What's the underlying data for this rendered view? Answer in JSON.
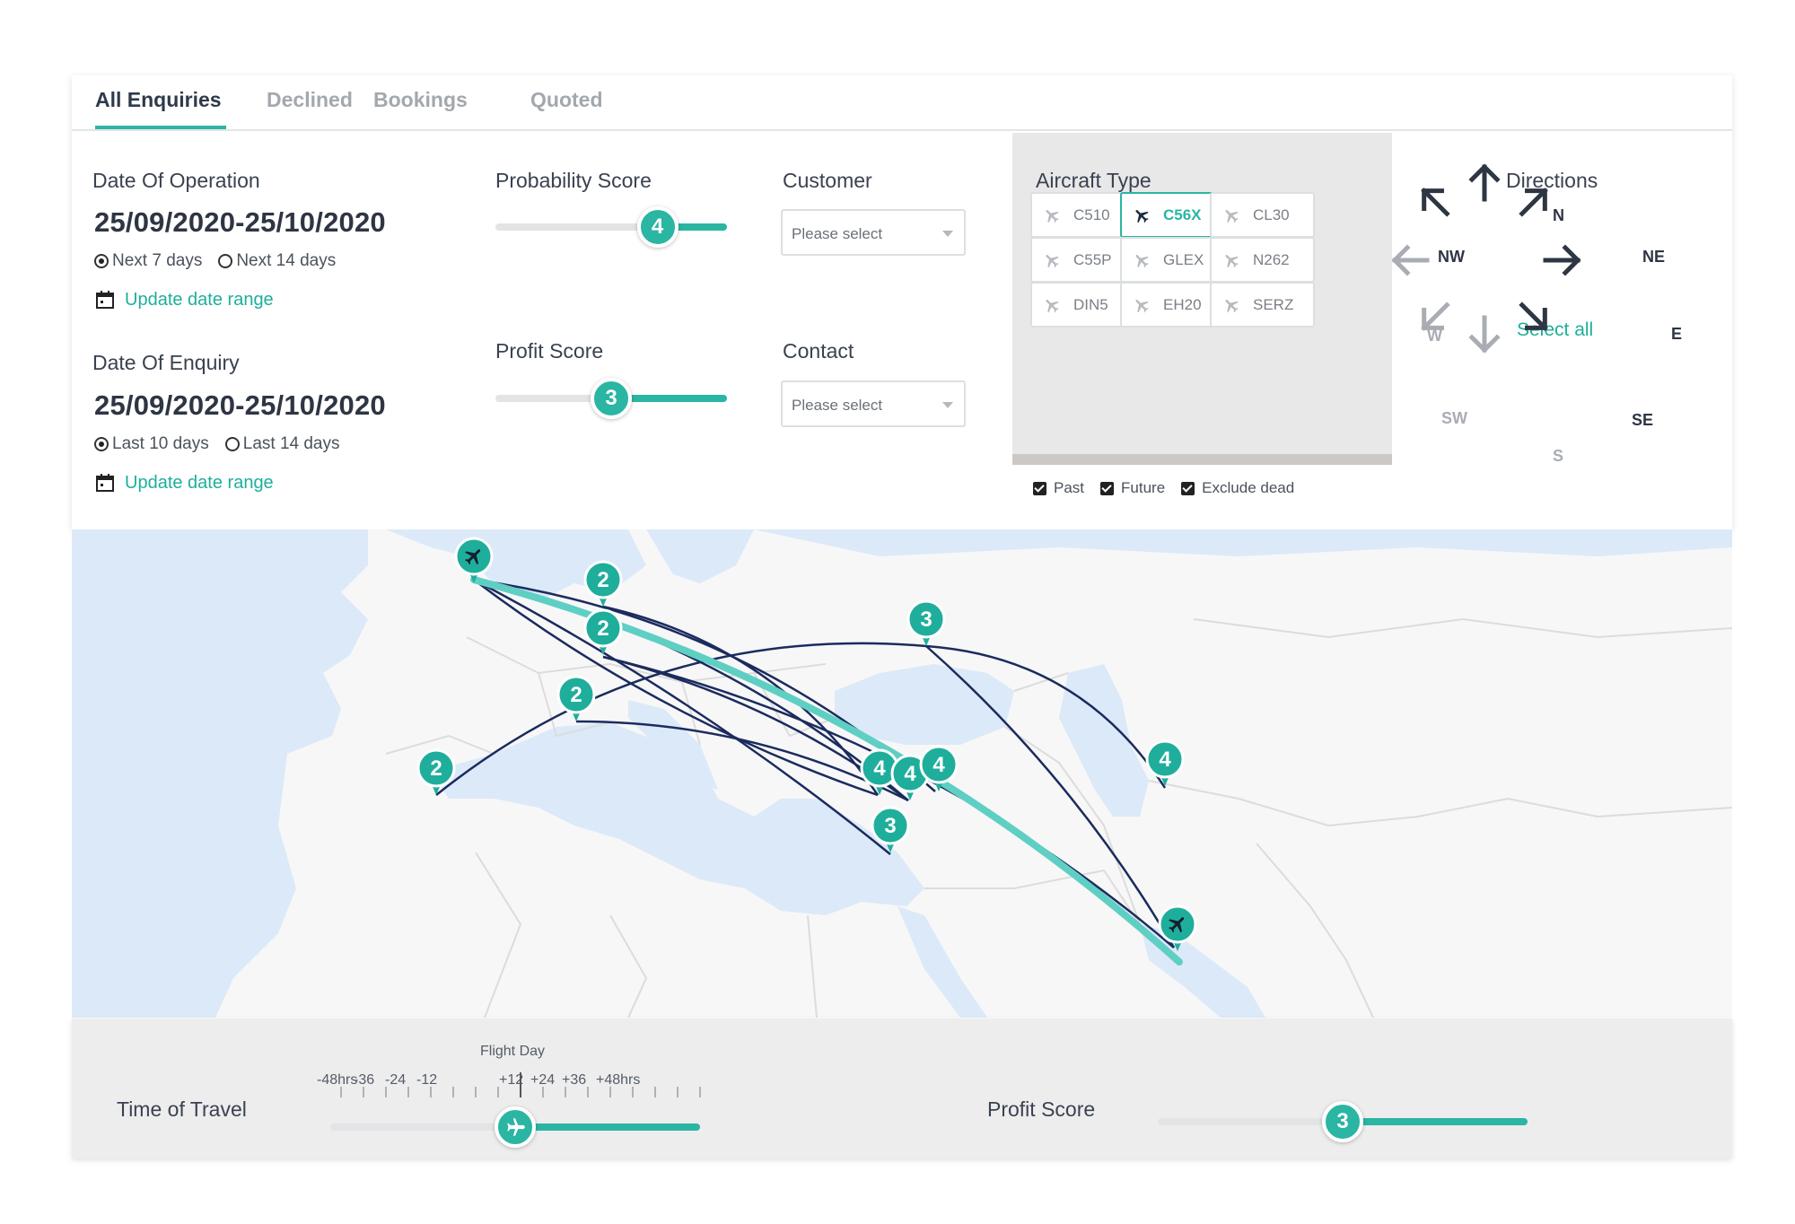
{
  "tabs": [
    {
      "label": "All Enquiries",
      "active": true
    },
    {
      "label": "Declined",
      "active": false
    },
    {
      "label": "Bookings",
      "active": false
    },
    {
      "label": "Quoted",
      "active": false
    }
  ],
  "filters": {
    "date_of_operation": {
      "label": "Date Of Operation",
      "range": "25/09/2020-25/10/2020",
      "options": [
        {
          "label": "Next 7 days",
          "selected": true
        },
        {
          "label": "Next 14 days",
          "selected": false
        }
      ],
      "update_link": "Update date range"
    },
    "date_of_enquiry": {
      "label": "Date Of Enquiry",
      "range": "25/09/2020-25/10/2020",
      "options": [
        {
          "label": "Last 10 days",
          "selected": true
        },
        {
          "label": "Last 14 days",
          "selected": false
        }
      ],
      "update_link": "Update date range"
    },
    "probability_score": {
      "label": "Probability Score",
      "value": "4",
      "fraction": 0.7
    },
    "profit_score": {
      "label": "Profit Score",
      "value": "3",
      "fraction": 0.5
    },
    "customer": {
      "label": "Customer",
      "placeholder": "Please select"
    },
    "contact": {
      "label": "Contact",
      "placeholder": "Please select"
    }
  },
  "aircraft": {
    "label": "Aircraft Type",
    "types": [
      {
        "code": "C510",
        "selected": false
      },
      {
        "code": "C56X",
        "selected": true
      },
      {
        "code": "CL30",
        "selected": false
      },
      {
        "code": "C55P",
        "selected": false
      },
      {
        "code": "GLEX",
        "selected": false
      },
      {
        "code": "N262",
        "selected": false
      },
      {
        "code": "DIN5",
        "selected": false
      },
      {
        "code": "EH20",
        "selected": false
      },
      {
        "code": "SERZ",
        "selected": false
      }
    ],
    "checkboxes": [
      {
        "label": "Past",
        "checked": true
      },
      {
        "label": "Future",
        "checked": true
      },
      {
        "label": "Exclude dead",
        "checked": true
      }
    ]
  },
  "directions": {
    "label": "Directions",
    "select_all": "Select all",
    "n": "N",
    "ne": "NE",
    "e": "E",
    "se": "SE",
    "s": "S",
    "sw": "SW",
    "w": "W",
    "nw": "NW",
    "colors": {
      "active": "#2e3543",
      "inactive": "#a9adb3"
    }
  },
  "map": {
    "markers": [
      "2",
      "2",
      "3",
      "2",
      "2",
      "4",
      "4",
      "4",
      "3",
      "4"
    ],
    "colors": {
      "land": "#ffffff",
      "sea": "#dce9f8",
      "route": "#1b2b5e",
      "highlight": "#5fcfc4",
      "marker": "#1fae9b"
    }
  },
  "bottom": {
    "time_of_travel": {
      "label": "Time of Travel",
      "caption": "Flight Day",
      "ticks": [
        "-48hrs",
        "-36",
        "-24",
        "-12",
        "+12",
        "+24",
        "+36",
        "+48hrs"
      ],
      "fraction": 0.5
    },
    "profit_score": {
      "label": "Profit Score",
      "value": "3",
      "fraction": 0.5
    }
  }
}
